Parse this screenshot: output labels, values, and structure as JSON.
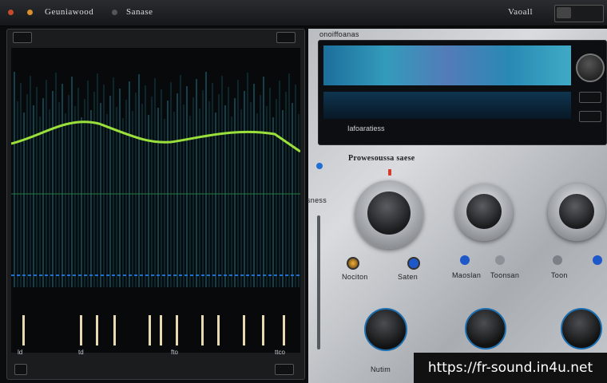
{
  "titlebar": {
    "app_name": "Geuniawood",
    "menu_label": "Sanase",
    "right_label": "Vaoall"
  },
  "display": {
    "header": "onoiffoanas",
    "caption": "Iafoaratiess"
  },
  "panel": {
    "title": "Prowesoussa saese",
    "side_label": "sness"
  },
  "controls": {
    "bottom_left_label": "Nociton",
    "bottom_mid_label": "Saten",
    "mid_label_1": "Maoslan",
    "mid_label_2": "Toonsan",
    "mid_label_3": "Toon",
    "bottom_title": "Nutim"
  },
  "watermark": "https://fr-sound.in4u.net"
}
